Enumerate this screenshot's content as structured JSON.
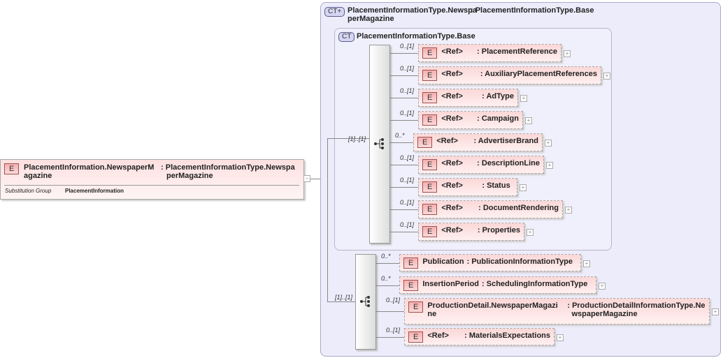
{
  "root": {
    "badge": "E",
    "name": "PlacementInformation.NewspaperMagazine",
    "name_lines": [
      "PlacementInformation.NewspaperM",
      "agazine"
    ],
    "type_lines": [
      "PlacementInformationType.Newspa",
      "perMagazine"
    ],
    "subst_label": "Substitution Group",
    "subst_value": "PlacementInformation",
    "collapse": "−"
  },
  "outer_ct": {
    "badge": "CT+",
    "name_lines": [
      "PlacementInformationType.Newspa",
      "perMagazine"
    ],
    "base": ": PlacementInformationType.Base"
  },
  "inner_ct": {
    "badge": "CT",
    "name": "PlacementInformationType.Base"
  },
  "seq1": {
    "card": "[1]..[1]",
    "items": [
      {
        "card": "0..[1]",
        "ref": "<Ref>",
        "name": ": PlacementReference"
      },
      {
        "card": "0..[1]",
        "ref": "<Ref>",
        "name": ": AuxiliaryPlacementReferences"
      },
      {
        "card": "0..[1]",
        "ref": "<Ref>",
        "name": ": AdType"
      },
      {
        "card": "0..[1]",
        "ref": "<Ref>",
        "name": ": Campaign"
      },
      {
        "card": "0..*",
        "ref": "<Ref>",
        "name": ": AdvertiserBrand"
      },
      {
        "card": "0..[1]",
        "ref": "<Ref>",
        "name": ": DescriptionLine"
      },
      {
        "card": "0..[1]",
        "ref": "<Ref>",
        "name": ": Status"
      },
      {
        "card": "0..[1]",
        "ref": "<Ref>",
        "name": ": DocumentRendering"
      },
      {
        "card": "0..[1]",
        "ref": "<Ref>",
        "name": ": Properties"
      }
    ]
  },
  "seq2": {
    "card": "[1]..[1]",
    "items": [
      {
        "card": "0..*",
        "name": "Publication",
        "type": ": PublicationInformationType"
      },
      {
        "card": "0..*",
        "name": "InsertionPeriod",
        "type": ": SchedulingInformationType"
      },
      {
        "card": "0..[1]",
        "name": "ProductionDetail.NewspaperMagazi\nne",
        "type": ": ProductionDetailInformationType.Ne\n  wspaperMagazine"
      },
      {
        "card": "0..[1]",
        "ref": "<Ref>",
        "name": ": MaterialsExpectations"
      }
    ]
  },
  "icons": {
    "badge": "E",
    "expand": "+"
  }
}
